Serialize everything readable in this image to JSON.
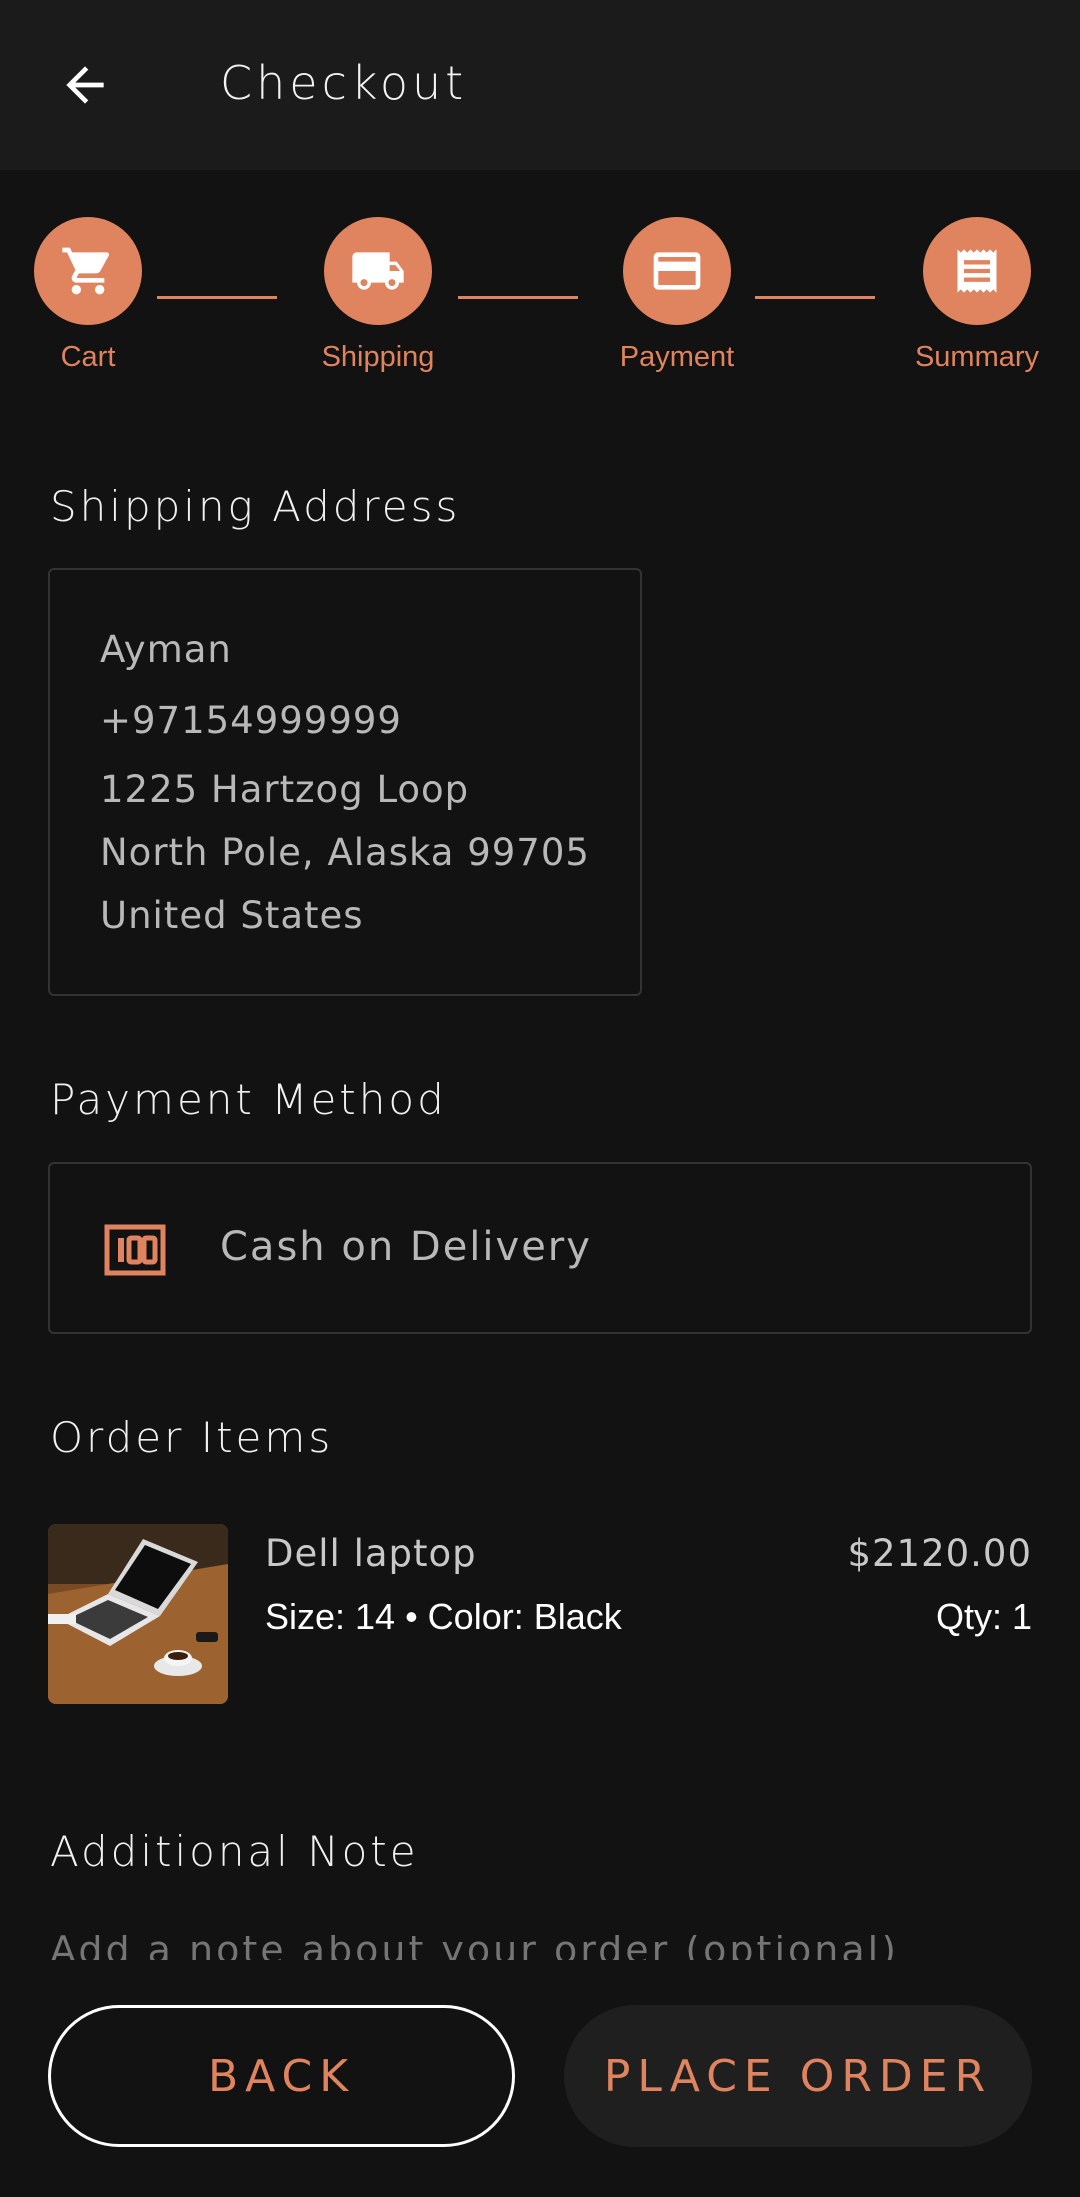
{
  "appbar": {
    "title": "Checkout",
    "back_icon": "arrow-left-icon"
  },
  "stepper": {
    "accent": "#e0845f",
    "steps": [
      {
        "label": "Cart",
        "icon": "cart-icon"
      },
      {
        "label": "Shipping",
        "icon": "truck-icon"
      },
      {
        "label": "Payment",
        "icon": "credit-card-icon"
      },
      {
        "label": "Summary",
        "icon": "receipt-icon"
      }
    ]
  },
  "shipping": {
    "title": "Shipping Address",
    "name": "Ayman",
    "phone": "+97154999999",
    "street": "1225 Hartzog Loop",
    "city_line": "North Pole, Alaska 99705",
    "country": "United States"
  },
  "payment": {
    "title": "Payment Method",
    "method": "Cash on Delivery",
    "icon": "cash-icon"
  },
  "order": {
    "title": "Order Items",
    "items": [
      {
        "name": "Dell laptop",
        "meta": "Size: 14 • Color: Black",
        "price": "$2120.00",
        "qty": "Qty: 1"
      }
    ]
  },
  "note": {
    "title": "Additional Note",
    "placeholder": "Add a note about your order (optional)"
  },
  "actions": {
    "back_label": "BACK",
    "place_label": "PLACE ORDER"
  }
}
